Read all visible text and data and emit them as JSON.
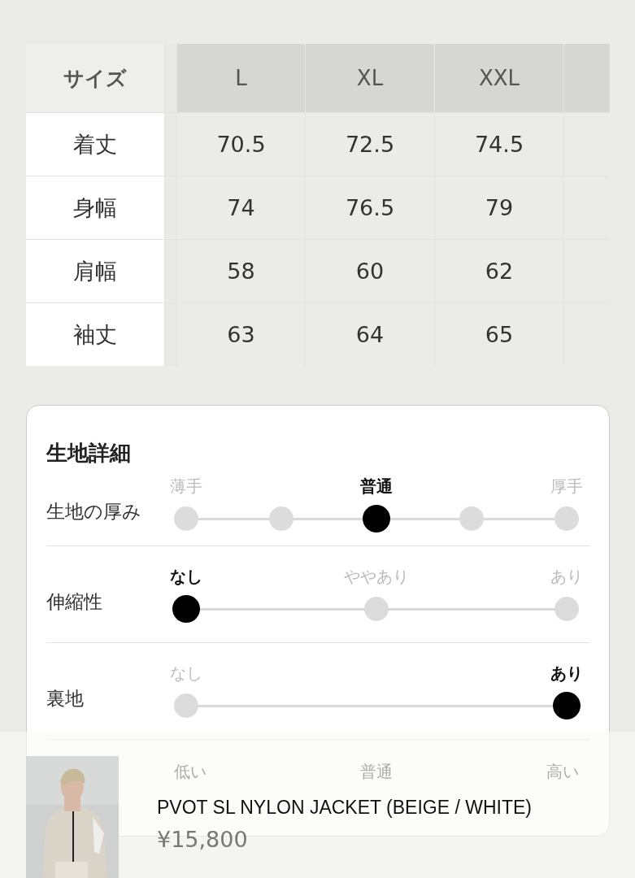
{
  "size_table": {
    "corner": "サイズ",
    "columns": [
      "L",
      "XL",
      "XXL"
    ],
    "rows": [
      {
        "label": "着丈",
        "values": [
          "70.5",
          "72.5",
          "74.5"
        ]
      },
      {
        "label": "身幅",
        "values": [
          "74",
          "76.5",
          "79"
        ]
      },
      {
        "label": "肩幅",
        "values": [
          "58",
          "60",
          "62"
        ]
      },
      {
        "label": "袖丈",
        "values": [
          "63",
          "64",
          "65"
        ]
      }
    ]
  },
  "fabric_details": {
    "title": "生地詳細",
    "rows": [
      {
        "label": "生地の厚み",
        "points": [
          {
            "label": "薄手",
            "selected": false
          },
          {
            "selected": false
          },
          {
            "label": "普通",
            "selected": true
          },
          {
            "selected": false
          },
          {
            "label": "厚手",
            "selected": false
          }
        ]
      },
      {
        "label": "伸縮性",
        "points": [
          {
            "label": "なし",
            "selected": true
          },
          {
            "label": "ややあり",
            "selected": false
          },
          {
            "label": "あり",
            "selected": false
          }
        ]
      },
      {
        "label": "裏地",
        "points": [
          {
            "label": "なし",
            "selected": false
          },
          {
            "label": "あり",
            "selected": true
          }
        ]
      },
      {
        "kind": "covered",
        "labels": [
          "低い",
          "普通",
          "高い"
        ]
      }
    ]
  },
  "product_bar": {
    "name": "PVOT SL NYLON JACKET (BEIGE / WHITE)",
    "price": "¥15,800"
  }
}
